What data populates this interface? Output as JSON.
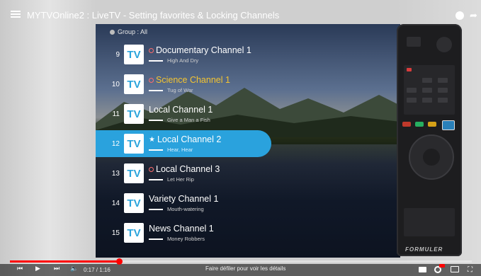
{
  "video": {
    "title": "MYTVOnline2 : LiveTV - Setting favorites & Locking Channels",
    "time_current": "0:17",
    "time_total": "1:16",
    "time_sep": " / ",
    "scroll_hint": "Faire défiler pour voir les détails",
    "progress_fraction": 0.23
  },
  "group": {
    "label": "Group : All"
  },
  "channels": [
    {
      "number": "9",
      "logo": "TV",
      "name": "Documentary Channel 1",
      "program": "High And Dry",
      "locked": true,
      "favorite": false,
      "selected": false
    },
    {
      "number": "10",
      "logo": "TV",
      "name": "Science Channel 1",
      "program": "Tug of War",
      "locked": true,
      "favorite": false,
      "selected": false,
      "highlight": true
    },
    {
      "number": "11",
      "logo": "TV",
      "name": "Local Channel 1",
      "program": "Give a Man a Fish",
      "locked": false,
      "favorite": false,
      "selected": false
    },
    {
      "number": "12",
      "logo": "TV",
      "name": "Local Channel 2",
      "program": "Hear, Hear",
      "locked": false,
      "favorite": true,
      "selected": true
    },
    {
      "number": "13",
      "logo": "TV",
      "name": "Local Channel 3",
      "program": "Let Her Rip",
      "locked": true,
      "favorite": false,
      "selected": false
    },
    {
      "number": "14",
      "logo": "TV",
      "name": "Variety Channel 1",
      "program": "Mouth-watering",
      "locked": false,
      "favorite": false,
      "selected": false
    },
    {
      "number": "15",
      "logo": "TV",
      "name": "News Channel 1",
      "program": "Money Robbers",
      "locked": false,
      "favorite": false,
      "selected": false
    }
  ],
  "remote": {
    "brand": "FORMULER"
  },
  "colors": {
    "accent": "#2aa2dd",
    "favorite_text": "#f4c430",
    "lock": "#ff6d6d",
    "progress": "#ff0000"
  }
}
